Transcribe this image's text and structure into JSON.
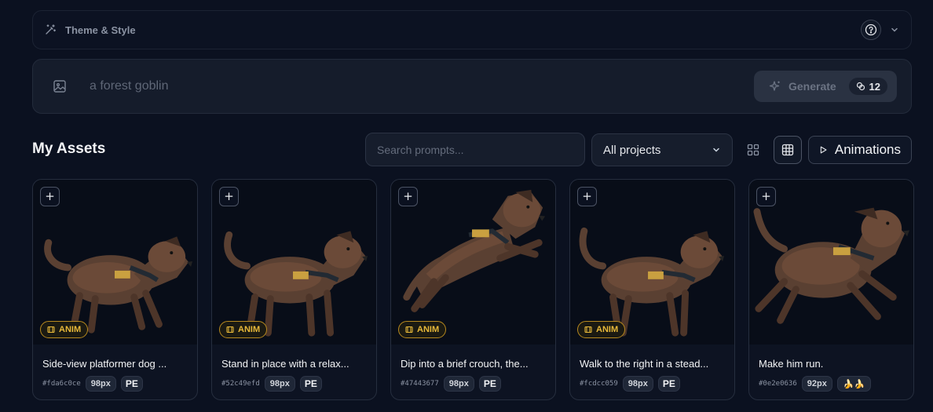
{
  "theme_bar": {
    "label": "Theme & Style"
  },
  "prompt": {
    "placeholder": "a forest goblin",
    "generate_label": "Generate",
    "credits": "12"
  },
  "assets": {
    "title": "My Assets",
    "search_placeholder": "Search prompts...",
    "project_filter": "All projects",
    "animations_label": "Animations"
  },
  "cards": [
    {
      "title": "Side-view platformer dog ...",
      "hash": "#fda6c0ce",
      "size": "98px",
      "badge": "ANIM",
      "tag": "PE"
    },
    {
      "title": "Stand in place with a relax...",
      "hash": "#52c49efd",
      "size": "98px",
      "badge": "ANIM",
      "tag": "PE"
    },
    {
      "title": "Dip into a brief crouch, the...",
      "hash": "#47443677",
      "size": "98px",
      "badge": "ANIM",
      "tag": "PE"
    },
    {
      "title": "Walk to the right in a stead...",
      "hash": "#fcdcc059",
      "size": "98px",
      "badge": "ANIM",
      "tag": "PE"
    },
    {
      "title": "Make him run.",
      "hash": "#0e2e0636",
      "size": "92px",
      "tag_emoji": "🍌🍌"
    }
  ],
  "colors": {
    "background": "#0b1120",
    "accent_gold": "#e8b93a",
    "dog_fur": "#5a4032"
  }
}
